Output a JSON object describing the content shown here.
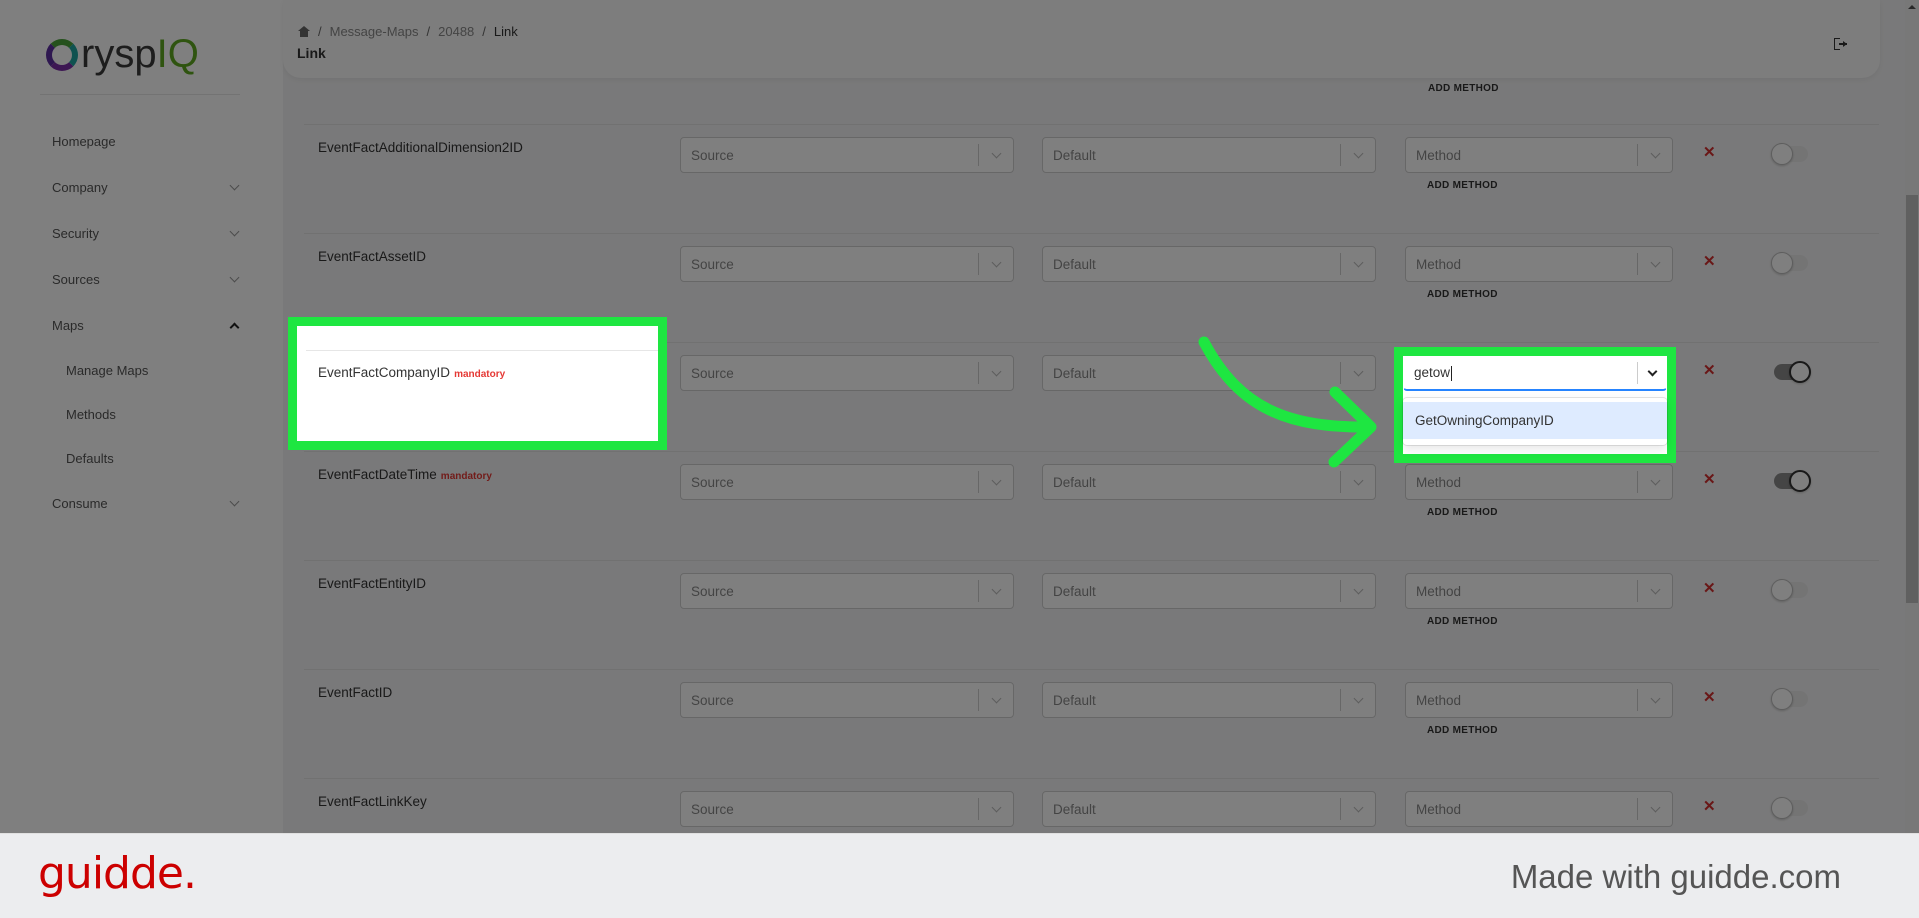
{
  "logo": {
    "c": "C",
    "rysp": "rysp",
    "iq": "IQ"
  },
  "sidebar": {
    "items": [
      {
        "label": "Homepage",
        "chevron": "none"
      },
      {
        "label": "Company",
        "chevron": "down"
      },
      {
        "label": "Security",
        "chevron": "down"
      },
      {
        "label": "Sources",
        "chevron": "down"
      },
      {
        "label": "Maps",
        "chevron": "up"
      }
    ],
    "subitems": [
      {
        "label": "Manage Maps"
      },
      {
        "label": "Methods"
      },
      {
        "label": "Defaults"
      }
    ],
    "after": {
      "label": "Consume",
      "chevron": "down"
    }
  },
  "header": {
    "breadcrumb": [
      "Message-Maps",
      "20488",
      "Link"
    ],
    "title": "Link",
    "home_icon": "home-icon",
    "logout_icon": "logout-icon"
  },
  "prev_row": {
    "add_method": "ADD METHOD"
  },
  "rows": [
    {
      "label": "EventFactAdditionalDimension2ID",
      "mandatory": "",
      "source": "Source",
      "default": "Default",
      "method": "Method",
      "add_method": "ADD METHOD",
      "toggle_on": false
    },
    {
      "label": "EventFactAssetID",
      "mandatory": "",
      "source": "Source",
      "default": "Default",
      "method": "Method",
      "add_method": "ADD METHOD",
      "toggle_on": false
    },
    {
      "label": "EventFactCompanyID",
      "mandatory": "mandatory",
      "source": "Source",
      "default": "Default",
      "method": "",
      "add_method": "",
      "toggle_on": true
    },
    {
      "label": "EventFactDateTime",
      "mandatory": "mandatory",
      "source": "Source",
      "default": "Default",
      "method": "Method",
      "add_method": "ADD METHOD",
      "toggle_on": true
    },
    {
      "label": "EventFactEntityID",
      "mandatory": "",
      "source": "Source",
      "default": "Default",
      "method": "Method",
      "add_method": "ADD METHOD",
      "toggle_on": false
    },
    {
      "label": "EventFactID",
      "mandatory": "",
      "source": "Source",
      "default": "Default",
      "method": "Method",
      "add_method": "ADD METHOD",
      "toggle_on": false
    },
    {
      "label": "EventFactLinkKey",
      "mandatory": "",
      "source": "Source",
      "default": "Default",
      "method": "Method",
      "add_method": "",
      "toggle_on": false
    }
  ],
  "delete_glyph": "✕",
  "highlight": {
    "label": "EventFactCompanyID",
    "mandatory": "mandatory",
    "method_input_value": "getow",
    "dropdown_options": [
      "GetOwningCompanyID"
    ]
  },
  "colors": {
    "highlight": "#1ee641",
    "mandatory": "#e53935",
    "delete": "#d32f2f",
    "option_bg": "#deebff",
    "focus": "#2684ff",
    "brand_red": "#cc0000"
  },
  "footer": {
    "brand": "guidde.",
    "tagline": "Made with guidde.com"
  }
}
